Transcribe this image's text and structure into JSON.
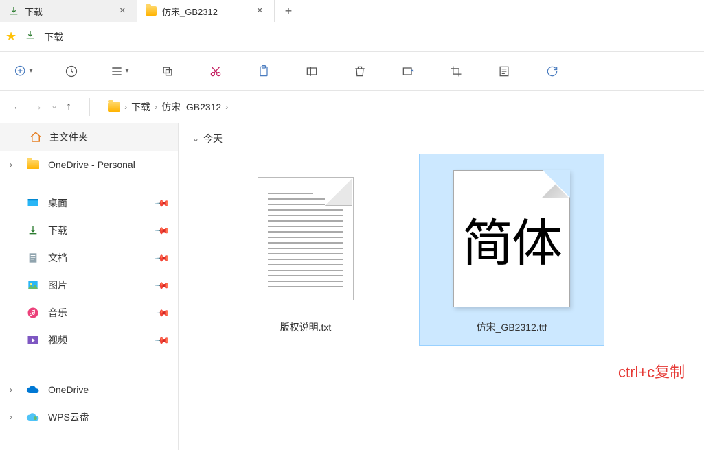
{
  "tabs": [
    {
      "label": "下载",
      "icon": "download"
    },
    {
      "label": "仿宋_GB2312",
      "icon": "folder"
    }
  ],
  "address": {
    "label": "下载"
  },
  "breadcrumb": {
    "items": [
      "下载",
      "仿宋_GB2312"
    ]
  },
  "sidebar": {
    "home": "主文件夹",
    "onedrive_personal": "OneDrive - Personal",
    "quick": [
      {
        "label": "桌面",
        "icon": "desktop"
      },
      {
        "label": "下载",
        "icon": "download"
      },
      {
        "label": "文档",
        "icon": "document"
      },
      {
        "label": "图片",
        "icon": "picture"
      },
      {
        "label": "音乐",
        "icon": "music"
      },
      {
        "label": "视频",
        "icon": "video"
      }
    ],
    "cloud": [
      {
        "label": "OneDrive",
        "icon": "cloud-blue"
      },
      {
        "label": "WPS云盘",
        "icon": "cloud-multi"
      }
    ]
  },
  "content": {
    "group": "今天",
    "files": [
      {
        "name": "版权说明.txt",
        "type": "txt"
      },
      {
        "name": "仿宋_GB2312.ttf",
        "type": "font",
        "preview": "简体",
        "selected": true
      }
    ]
  },
  "annotation": "ctrl+c复制"
}
